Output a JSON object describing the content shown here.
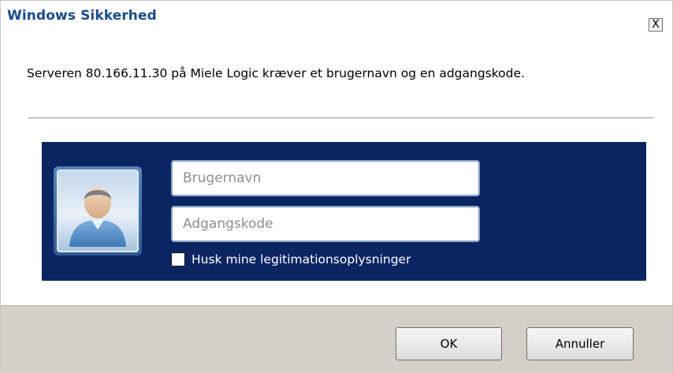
{
  "window": {
    "title": "Windows Sikkerhed",
    "close_label": "X"
  },
  "dialog": {
    "message": "Serveren 80.166.11.30 på Miele Logic kræver et brugernavn og en adgangskode."
  },
  "credentials": {
    "avatar_icon": "user-avatar-icon",
    "username_placeholder": "Brugernavn",
    "username_value": "",
    "password_placeholder": "Adgangskode",
    "password_value": "",
    "remember_label": "Husk mine legitimationsoplysninger",
    "remember_checked": false,
    "panel_color": "#0b2563"
  },
  "buttons": {
    "ok_label": "OK",
    "cancel_label": "Annuller"
  }
}
